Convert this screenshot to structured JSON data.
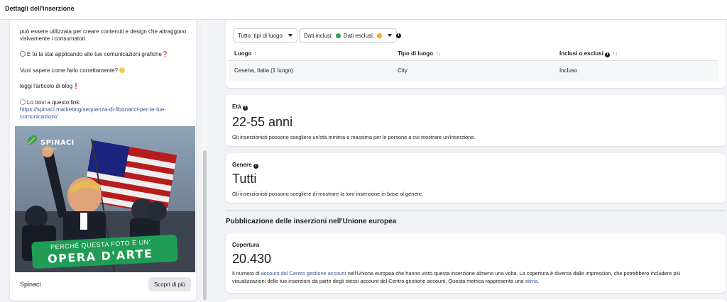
{
  "header": {
    "title": "Dettagli dell'inserzione"
  },
  "ad": {
    "body_lines": [
      "può essere utilizzata per creare contenuti e design che attraggono",
      "visivamente i consumatori."
    ],
    "question1": "E tu la stai applicando alle tue comunicazioni grafiche",
    "question2": "Vuoi sapere come farlo correttamente?",
    "read_blog": "leggi l'articolo di blog",
    "find_it": "Lo trovi a questo link:",
    "url_line1": "https://spinaci.marketing/sequenza-di-fibonacci-per-le-tue-",
    "url_line2": "comunicazioni/",
    "exclaim": "❗",
    "question_mark": "❓",
    "creative": {
      "logo_name": "SPINACI",
      "logo_sub": "marketing",
      "banner_top": "PERCHÉ QUESTA FOTO È UN'",
      "banner_main": "OPERA D'ARTE"
    },
    "page_name": "Spinaci",
    "cta_label": "Scopri di più"
  },
  "location": {
    "type_filter": "Tutto: tipi di luogo",
    "data_filter_included": "Dati inclusi:",
    "data_filter_excluded": "Dati esclusi:",
    "columns": [
      "Luogo",
      "Tipo di luogo",
      "Inclusi o esclusi"
    ],
    "rows": [
      {
        "place": "Cesena, Italia (1 luogo)",
        "type": "City",
        "status": "Incluso"
      }
    ]
  },
  "age": {
    "label": "Età",
    "value": "22-55 anni",
    "description": "Gli inserzionisti possono scegliere un'età minima e massima per le persone a cui mostrare un'inserzione."
  },
  "gender": {
    "label": "Genere",
    "value": "Tutti",
    "description": "Gli inserzionisti possono scegliere di mostrare la loro inserzione in base al genere."
  },
  "eu": {
    "heading": "Pubblicazione delle inserzioni nell'Unione europea",
    "coverage_label": "Copertura",
    "coverage_value": "20.430",
    "desc_part1": "Il numero di ",
    "desc_link1": "account del Centro gestione account",
    "desc_part2": " nell'Unione europea che hanno visto questa inserzione almeno una volta. La copertura è diversa dalle impression, che potrebbero includere più",
    "desc_part3": "visualizzazioni delle tue inserzioni da parte degli stessi account del Centro gestione account. Questa metrica rappresenta una ",
    "desc_link2": "stima",
    "desc_part4": "."
  },
  "colors": {
    "accent_blue": "#1877f2",
    "link_blue": "#385898",
    "included_green": "#31a24c",
    "excluded_orange": "#f5a623",
    "banner_green": "#1f9d55"
  }
}
